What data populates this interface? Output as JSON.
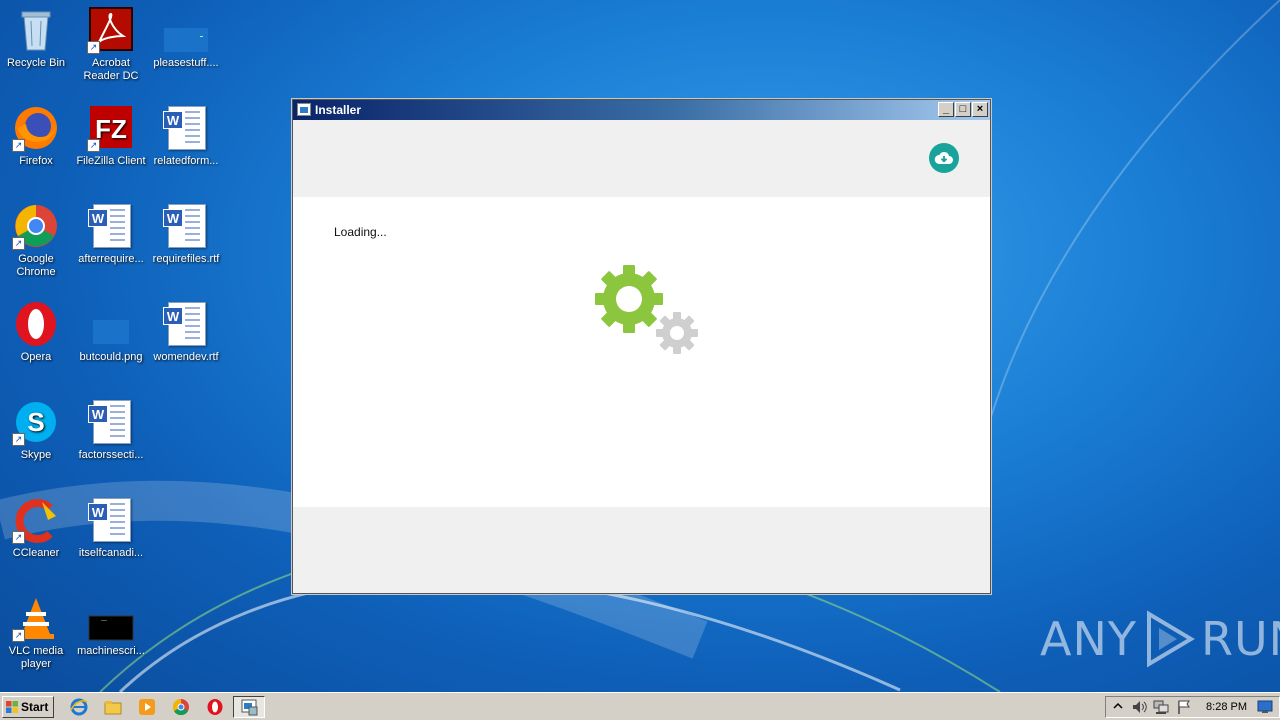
{
  "desktop": {
    "icons": [
      {
        "label": "Recycle Bin"
      },
      {
        "label": "Acrobat Reader DC"
      },
      {
        "label": "pleasestuff...."
      },
      {
        "label": "Firefox"
      },
      {
        "label": "FileZilla Client"
      },
      {
        "label": "relatedform..."
      },
      {
        "label": "Google Chrome"
      },
      {
        "label": "afterrequire..."
      },
      {
        "label": "requirefiles.rtf"
      },
      {
        "label": "Opera"
      },
      {
        "label": "butcould.png"
      },
      {
        "label": "womendev.rtf"
      },
      {
        "label": "Skype"
      },
      {
        "label": "factorssecti..."
      },
      {
        "label": "CCleaner"
      },
      {
        "label": "itselfcanadi..."
      },
      {
        "label": "VLC media player"
      },
      {
        "label": "machinescri..."
      }
    ]
  },
  "window": {
    "title": "Installer",
    "minimize": "_",
    "maximize": "□",
    "close": "×",
    "status": "Loading...",
    "header_icon": "cloud-download-icon",
    "accent": "#1aa39a",
    "gear_primary_color": "#8cc63f",
    "gear_secondary_color": "#cfcfcf"
  },
  "watermark": {
    "text_left": "ANY",
    "text_right": "RUN"
  },
  "taskbar": {
    "start_label": "Start",
    "clock": "8:28 PM"
  }
}
